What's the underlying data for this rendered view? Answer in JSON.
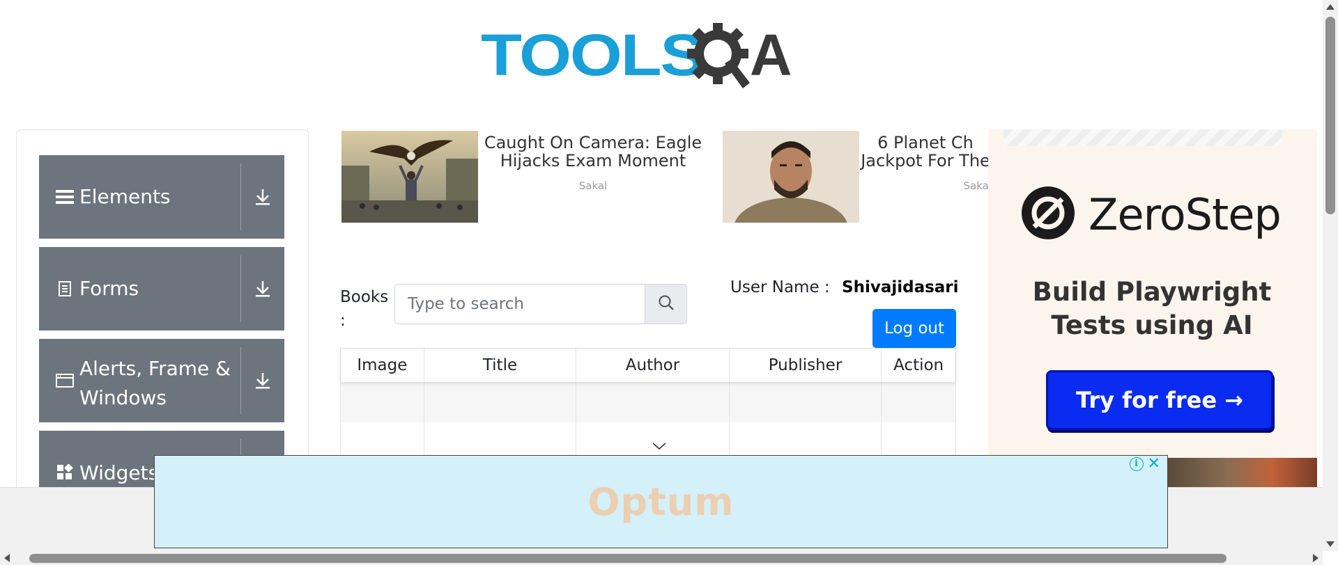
{
  "header": {
    "logo_text": "TOOLS",
    "logo_suffix": "A"
  },
  "sidebar": {
    "groups": [
      {
        "label": "Elements",
        "icon": "hamburger-icon"
      },
      {
        "label": "Forms",
        "icon": "document-icon"
      },
      {
        "label": "Alerts, Frame & Windows",
        "icon": "window-icon"
      },
      {
        "label": "Widgets",
        "icon": "widgets-icon"
      }
    ]
  },
  "news": [
    {
      "title": "Caught On Camera: Eagle Hijacks Exam Moment",
      "source": "Sakal"
    },
    {
      "title": "6 Planet Ch Jackpot For The",
      "source": "Sakal"
    }
  ],
  "search": {
    "label": "Books :",
    "placeholder": "Type to search"
  },
  "user": {
    "label": "User Name :",
    "name": "Shivajidasari",
    "logout_label": "Log out"
  },
  "table": {
    "columns": [
      "Image",
      "Title",
      "Author",
      "Publisher",
      "Action"
    ]
  },
  "ad_right": {
    "brand": "ZeroStep",
    "tagline": "Build Playwright Tests using AI",
    "cta": "Try for free →"
  },
  "ad_bottom": {
    "brand": "Optum",
    "info": "i",
    "close": "✕"
  },
  "colors": {
    "sidebar_group": "#6c757d",
    "primary": "#007bff",
    "logo_blue": "#1a9fd8"
  }
}
